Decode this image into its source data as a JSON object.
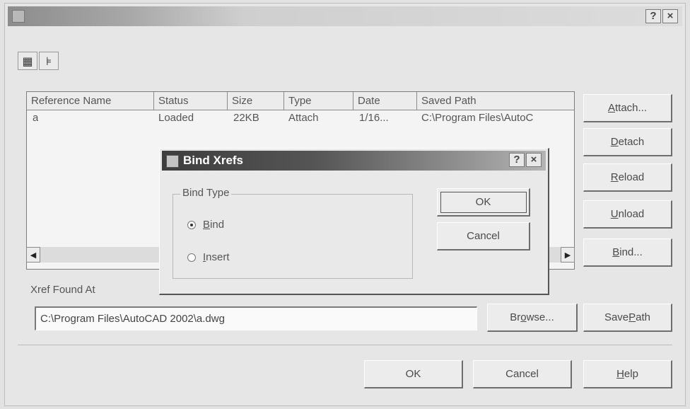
{
  "window": {
    "title_buttons": {
      "help": "?",
      "close": "×"
    }
  },
  "view_buttons": [
    {
      "icon": "list-view-icon",
      "glyph": "▦"
    },
    {
      "icon": "tree-view-icon",
      "glyph": "⊧"
    }
  ],
  "xref_list": {
    "columns": [
      "Reference Name",
      "Status",
      "Size",
      "Type",
      "Date",
      "Saved Path"
    ],
    "rows": [
      {
        "name": "a",
        "status": "Loaded",
        "size": "22KB",
        "type": "Attach",
        "date": "1/16...",
        "saved_path": "C:\\Program Files\\AutoC"
      }
    ],
    "scroll_left": "◀",
    "scroll_right": "▶"
  },
  "side_buttons": {
    "attach": {
      "pre": "",
      "ul": "A",
      "post": "ttach..."
    },
    "detach": {
      "pre": "",
      "ul": "D",
      "post": "etach"
    },
    "reload": {
      "pre": "",
      "ul": "R",
      "post": "eload"
    },
    "unload": {
      "pre": "",
      "ul": "U",
      "post": "nload"
    },
    "bind": {
      "pre": "",
      "ul": "B",
      "post": "ind..."
    }
  },
  "xref_found": {
    "label": "Xref Found At",
    "value": "C:\\Program Files\\AutoCAD 2002\\a.dwg",
    "browse": {
      "pre": "Br",
      "ul": "o",
      "post": "wse..."
    },
    "save_path": {
      "pre": "Save ",
      "ul": "P",
      "post": "ath"
    }
  },
  "footer": {
    "ok": "OK",
    "cancel": "Cancel",
    "help": {
      "pre": "",
      "ul": "H",
      "post": "elp"
    }
  },
  "bind_dialog": {
    "title": "Bind Xrefs",
    "title_buttons": {
      "help": "?",
      "close": "×"
    },
    "group_label": "Bind Type",
    "options": [
      {
        "pre": "",
        "ul": "B",
        "post": "ind",
        "selected": true
      },
      {
        "pre": "",
        "ul": "I",
        "post": "nsert",
        "selected": false
      }
    ],
    "ok": "OK",
    "cancel": "Cancel"
  }
}
